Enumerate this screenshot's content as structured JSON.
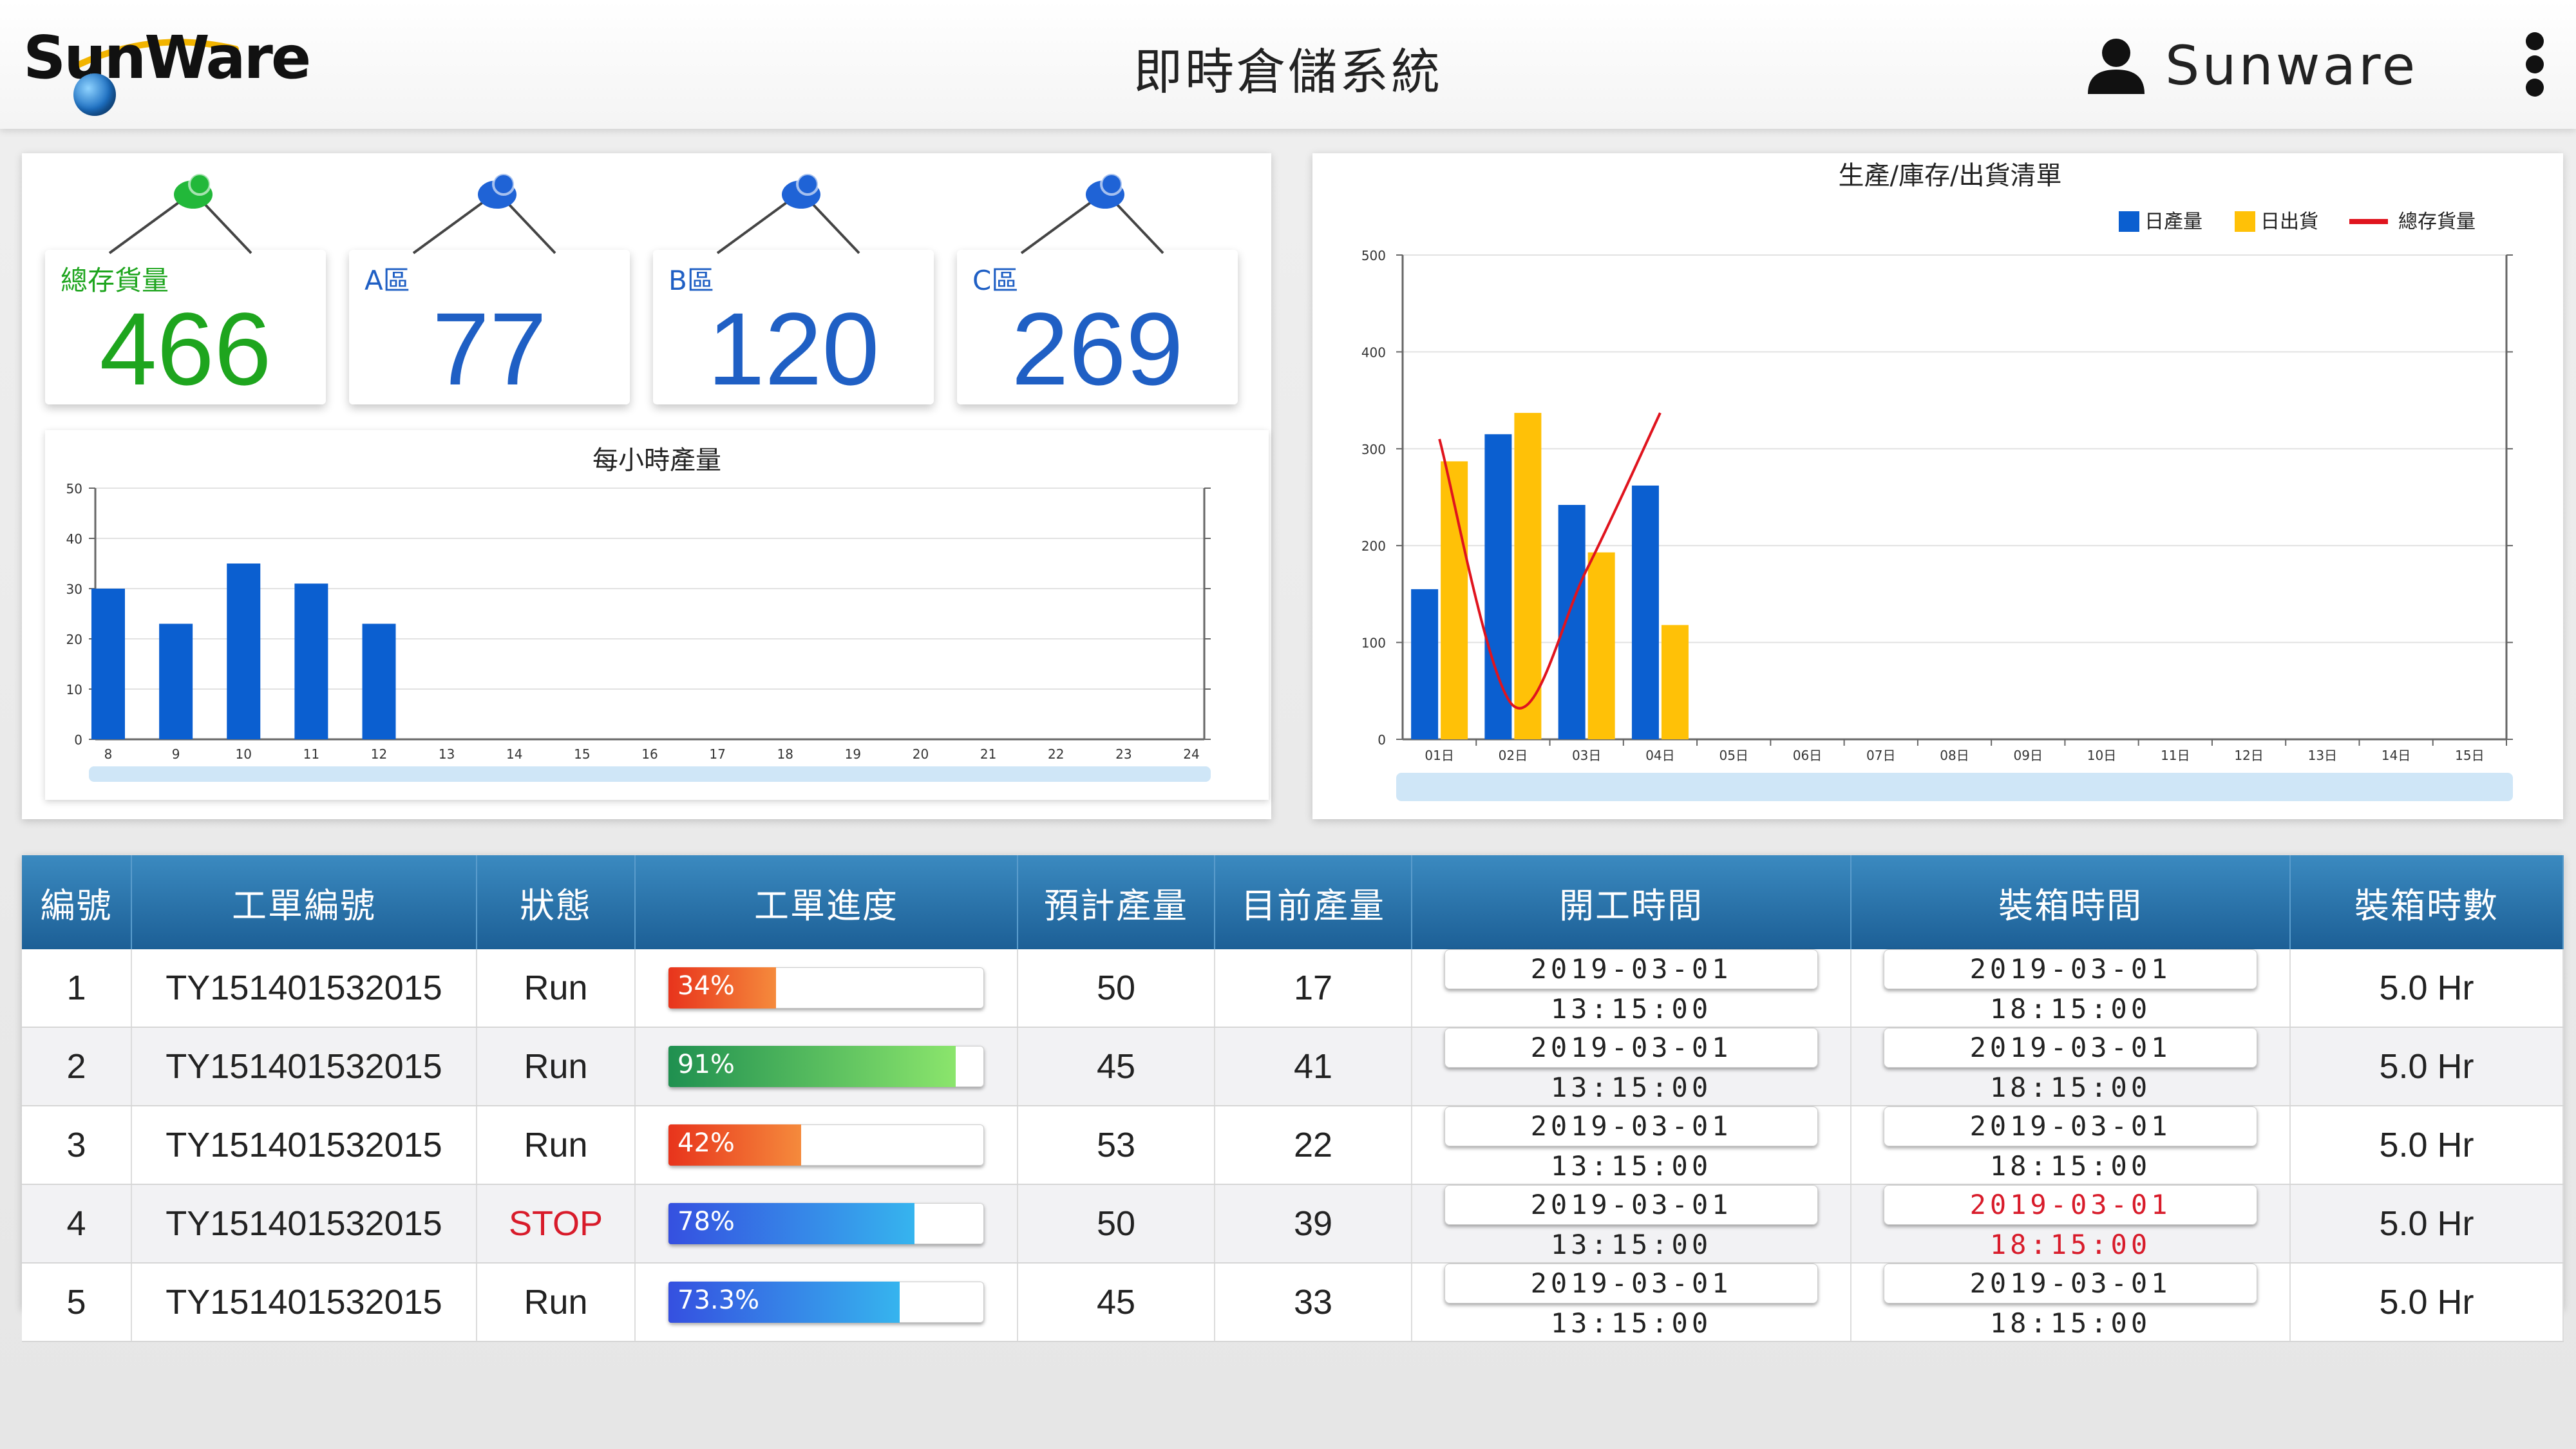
{
  "header": {
    "logo_text": "SunWare",
    "title": "即時倉儲系統",
    "user_name": "Sunware"
  },
  "kpis": [
    {
      "label": "總存貨量",
      "value": "466",
      "color": "#1ea51e"
    },
    {
      "label": "A區",
      "value": "77",
      "color": "#1f5fc4"
    },
    {
      "label": "B區",
      "value": "120",
      "color": "#1f5fc4"
    },
    {
      "label": "C區",
      "value": "269",
      "color": "#1f5fc4"
    }
  ],
  "colors": {
    "bar_blue": "#0b5fd0",
    "bar_yellow": "#ffc107",
    "line_red": "#e0141e",
    "header_blue": "#2a73ad",
    "stop_red": "#d81b2a"
  },
  "chart_data": [
    {
      "type": "bar",
      "title": "每小時產量",
      "categories": [
        "8",
        "9",
        "10",
        "11",
        "12",
        "13",
        "14",
        "15",
        "16",
        "17",
        "18",
        "19",
        "20",
        "21",
        "22",
        "23",
        "24"
      ],
      "values": [
        30,
        23,
        35,
        31,
        23,
        null,
        null,
        null,
        null,
        null,
        null,
        null,
        null,
        null,
        null,
        null,
        null
      ],
      "yticks": [
        0,
        10,
        20,
        30,
        40,
        50
      ],
      "ylim": [
        0,
        50
      ],
      "grid": true
    },
    {
      "type": "bar",
      "title": "生產/庫存/出貨清單",
      "categories": [
        "01日",
        "02日",
        "03日",
        "04日",
        "05日",
        "06日",
        "07日",
        "08日",
        "09日",
        "10日",
        "11日",
        "12日",
        "13日",
        "14日",
        "15日"
      ],
      "series": [
        {
          "name": "日產量",
          "type": "bar",
          "values": [
            155,
            315,
            242,
            262,
            null,
            null,
            null,
            null,
            null,
            null,
            null,
            null,
            null,
            null,
            null
          ]
        },
        {
          "name": "日出貨",
          "type": "bar",
          "values": [
            287,
            337,
            193,
            118,
            null,
            null,
            null,
            null,
            null,
            null,
            null,
            null,
            null,
            null,
            null
          ]
        },
        {
          "name": "總存貨量",
          "type": "line",
          "values": [
            310,
            35,
            175,
            337,
            null,
            null,
            null,
            null,
            null,
            null,
            null,
            null,
            null,
            null,
            null
          ]
        }
      ],
      "yticks": [
        0,
        100,
        200,
        300,
        400,
        500
      ],
      "ylim": [
        0,
        500
      ],
      "legend": "top-right",
      "grid": true
    }
  ],
  "table": {
    "headers": [
      "編號",
      "工單編號",
      "狀態",
      "工單進度",
      "預計產量",
      "目前產量",
      "開工時間",
      "裝箱時間",
      "裝箱時數"
    ],
    "rows": [
      {
        "no": "1",
        "order": "TY151401532015",
        "status": "Run",
        "progress": "34%",
        "progress_value": 34,
        "progress_colors": [
          "#e8341c",
          "#f58a3c"
        ],
        "planned": "50",
        "current": "17",
        "start": "2019-03-01  13:15:00",
        "pack": "2019-03-01  18:15:00",
        "pack_alert": false,
        "hours": "5.0 Hr"
      },
      {
        "no": "2",
        "order": "TY151401532015",
        "status": "Run",
        "progress": "91%",
        "progress_value": 91,
        "progress_colors": [
          "#1f9050",
          "#8be56c"
        ],
        "planned": "45",
        "current": "41",
        "start": "2019-03-01  13:15:00",
        "pack": "2019-03-01  18:15:00",
        "pack_alert": false,
        "hours": "5.0 Hr"
      },
      {
        "no": "3",
        "order": "TY151401532015",
        "status": "Run",
        "progress": "42%",
        "progress_value": 42,
        "progress_colors": [
          "#e8341c",
          "#f58a3c"
        ],
        "planned": "53",
        "current": "22",
        "start": "2019-03-01  13:15:00",
        "pack": "2019-03-01  18:15:00",
        "pack_alert": false,
        "hours": "5.0 Hr"
      },
      {
        "no": "4",
        "order": "TY151401532015",
        "status": "STOP",
        "progress": "78%",
        "progress_value": 78,
        "progress_colors": [
          "#3550e0",
          "#36b4ee"
        ],
        "planned": "50",
        "current": "39",
        "start": "2019-03-01  13:15:00",
        "pack": "2019-03-01  18:15:00",
        "pack_alert": true,
        "hours": "5.0 Hr"
      },
      {
        "no": "5",
        "order": "TY151401532015",
        "status": "Run",
        "progress": "73.3%",
        "progress_value": 73.3,
        "progress_colors": [
          "#3550e0",
          "#36b4ee"
        ],
        "planned": "45",
        "current": "33",
        "start": "2019-03-01  13:15:00",
        "pack": "2019-03-01  18:15:00",
        "pack_alert": false,
        "hours": "5.0 Hr"
      }
    ]
  }
}
